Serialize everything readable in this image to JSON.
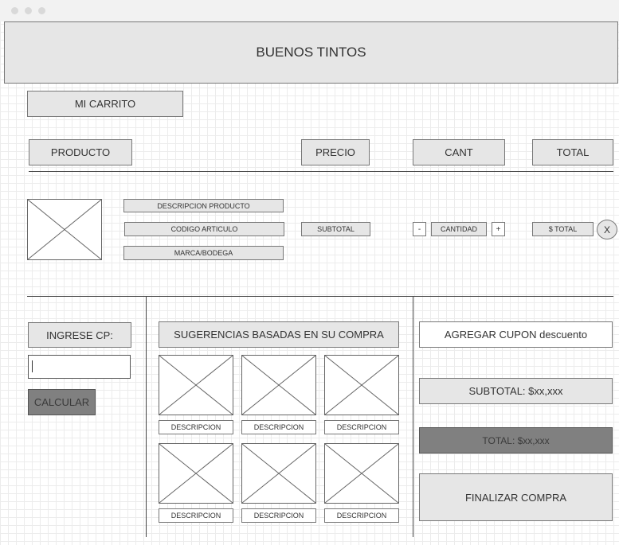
{
  "header": {
    "title": "BUENOS TINTOS"
  },
  "cart": {
    "title": "MI CARRITO"
  },
  "columns": {
    "product": "PRODUCTO",
    "price": "PRECIO",
    "qty": "CANT",
    "total": "TOTAL"
  },
  "item": {
    "description": "DESCRIPCION PRODUCTO",
    "code": "CODIGO ARTICULO",
    "brand": "MARCA/BODEGA",
    "subtotal": "SUBTOTAL",
    "minus": "-",
    "quantity": "CANTIDAD",
    "plus": "+",
    "total": "$ TOTAL",
    "remove": "X"
  },
  "shipping": {
    "label": "INGRESE CP:",
    "input_value": "",
    "calc_button": "CALCULAR"
  },
  "suggestions": {
    "title": "SUGERENCIAS BASADAS EN SU COMPRA",
    "items": [
      "DESCRIPCION",
      "DESCRIPCION",
      "DESCRIPCION",
      "DESCRIPCION",
      "DESCRIPCION",
      "DESCRIPCION"
    ]
  },
  "summary": {
    "coupon": "AGREGAR CUPON descuento",
    "subtotal": "SUBTOTAL: $xx,xxx",
    "total": "TOTAL: $xx,xxx",
    "checkout": "FINALIZAR COMPRA"
  }
}
